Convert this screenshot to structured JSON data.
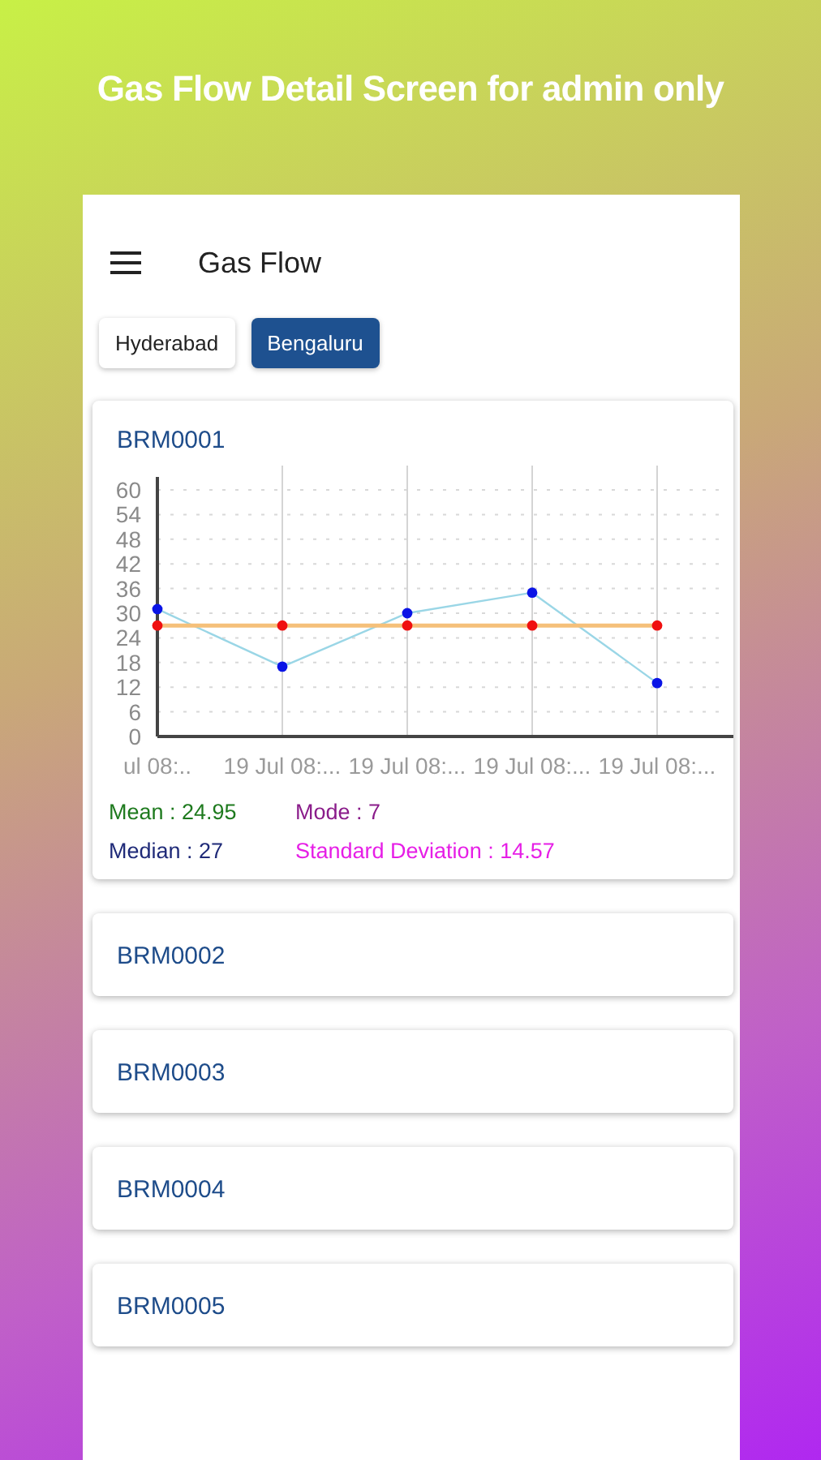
{
  "banner": {
    "title": "Gas Flow Detail Screen for admin only"
  },
  "app_bar": {
    "title": "Gas Flow"
  },
  "cities": [
    {
      "label": "Hyderabad",
      "selected": false
    },
    {
      "label": "Bengaluru",
      "selected": true
    }
  ],
  "devices": [
    {
      "name": "BRM0001",
      "expanded": true,
      "chart_data": {
        "type": "line",
        "categories": [
          "ul 08:..",
          "19 Jul 08:...",
          "19 Jul 08:...",
          "19 Jul 08:...",
          "19 Jul 08:..."
        ],
        "ylim": [
          0,
          60
        ],
        "yticks": [
          0,
          6,
          12,
          18,
          24,
          30,
          36,
          42,
          48,
          54,
          60
        ],
        "grid": true,
        "series": [
          {
            "color": "#0a14e6",
            "marker": true,
            "values": [
              31,
              17,
              30,
              35,
              13
            ]
          },
          {
            "color": "#f01010",
            "marker": true,
            "values": [
              27,
              27,
              27,
              27,
              27
            ]
          }
        ]
      },
      "stats": [
        {
          "text": "Mean : 24.95",
          "color": "#1e7a1e"
        },
        {
          "text": "Mode : 7",
          "color": "#8a1c8a"
        },
        {
          "text": "Median : 27",
          "color": "#1f2a78"
        },
        {
          "text": "Standard Deviation : 14.57",
          "color": "#e61ee6"
        }
      ]
    },
    {
      "name": "BRM0002",
      "expanded": false
    },
    {
      "name": "BRM0003",
      "expanded": false
    },
    {
      "name": "BRM0004",
      "expanded": false
    },
    {
      "name": "BRM0005",
      "expanded": false
    }
  ]
}
